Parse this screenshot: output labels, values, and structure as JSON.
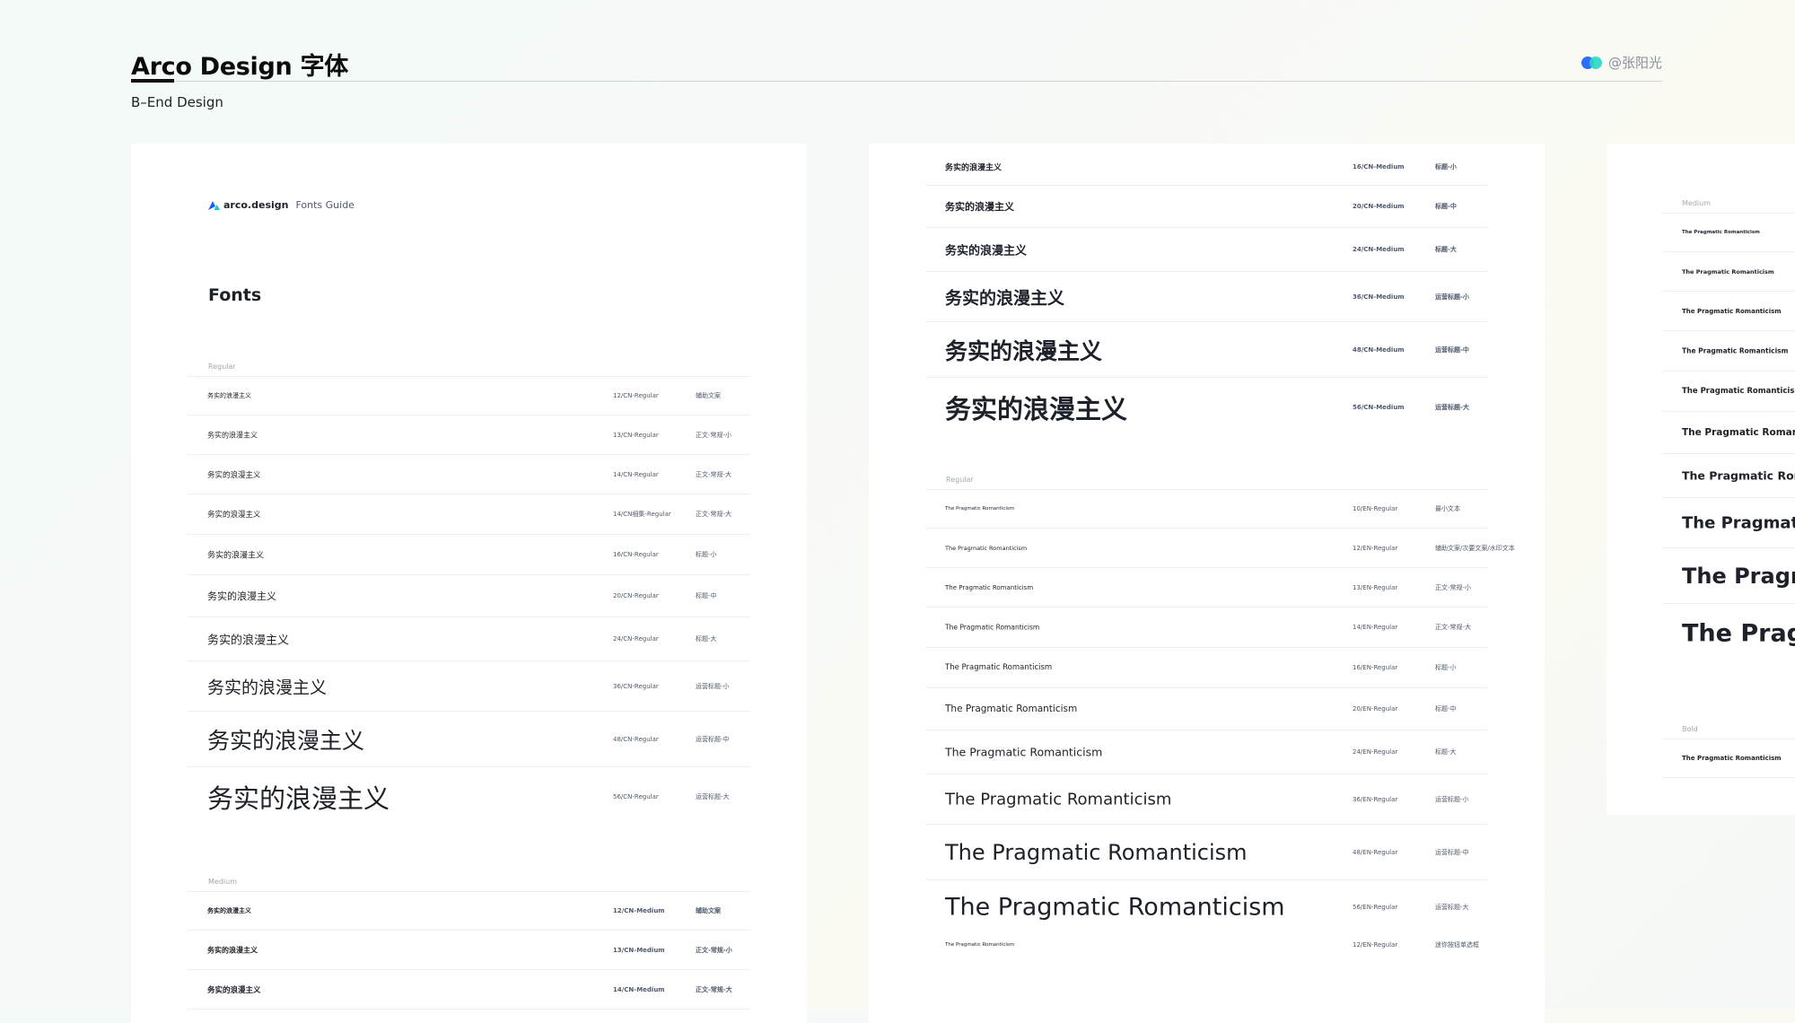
{
  "header": {
    "title": "Arco Design 字体",
    "subtitle": "B–End Design",
    "author": "@张阳光"
  },
  "card1": {
    "brand": "arco.design",
    "guide": "Fonts Guide",
    "heading": "Fonts",
    "regular_label": "Regular",
    "medium_label": "Medium",
    "regular_rows": [
      {
        "sample": "务实的浪漫主义",
        "spec": "12/CN-Regular",
        "use": "辅助文案"
      },
      {
        "sample": "务实的浪漫主义",
        "spec": "13/CN-Regular",
        "use": "正文-常规-小"
      },
      {
        "sample": "务实的浪漫主义",
        "spec": "14/CN-Regular",
        "use": "正文-常规-大"
      },
      {
        "sample": "务实的浪漫主义",
        "spec": "14/CN细集-Regular",
        "use": "正文-常规-大"
      },
      {
        "sample": "务实的浪漫主义",
        "spec": "16/CN-Regular",
        "use": "标题-小"
      },
      {
        "sample": "务实的浪漫主义",
        "spec": "20/CN-Regular",
        "use": "标题-中"
      },
      {
        "sample": "务实的浪漫主义",
        "spec": "24/CN-Regular",
        "use": "标题-大"
      },
      {
        "sample": "务实的浪漫主义",
        "spec": "36/CN-Regular",
        "use": "运营标题-小"
      },
      {
        "sample": "务实的浪漫主义",
        "spec": "48/CN-Regular",
        "use": "运营标题-中"
      },
      {
        "sample": "务实的浪漫主义",
        "spec": "56/CN-Regular",
        "use": "运营标题-大"
      }
    ],
    "medium_rows": [
      {
        "sample": "务实的浪漫主义",
        "spec": "12/CN-Medium",
        "use": "辅助文案"
      },
      {
        "sample": "务实的浪漫主义",
        "spec": "13/CN-Medium",
        "use": "正文-常规-小"
      },
      {
        "sample": "务实的浪漫主义",
        "spec": "14/CN-Medium",
        "use": "正文-常规-大"
      }
    ]
  },
  "card2": {
    "regular_label": "Regular",
    "medium_rows": [
      {
        "sample": "务实的浪漫主义",
        "spec": "16/CN-Medium",
        "use": "标题-小"
      },
      {
        "sample": "务实的浪漫主义",
        "spec": "20/CN-Medium",
        "use": "标题-中"
      },
      {
        "sample": "务实的浪漫主义",
        "spec": "24/CN-Medium",
        "use": "标题-大"
      },
      {
        "sample": "务实的浪漫主义",
        "spec": "36/CN-Medium",
        "use": "运营标题-小"
      },
      {
        "sample": "务实的浪漫主义",
        "spec": "48/CN-Medium",
        "use": "运营标题-中"
      },
      {
        "sample": "务实的浪漫主义",
        "spec": "56/CN-Medium",
        "use": "运营标题-大"
      }
    ],
    "en_rows": [
      {
        "sample": "The Pragmatic Romanticism",
        "spec": "10/EN-Regular",
        "use": "最小文本"
      },
      {
        "sample": "The Pragmatic Romanticism",
        "spec": "12/EN-Regular",
        "use": "辅助文案/次要文案/水印文本"
      },
      {
        "sample": "The Pragmatic Romanticism",
        "spec": "13/EN-Regular",
        "use": "正文-常规-小"
      },
      {
        "sample": "The Pragmatic Romanticism",
        "spec": "14/EN-Regular",
        "use": "正文-常规-大"
      },
      {
        "sample": "The Pragmatic Romanticism",
        "spec": "16/EN-Regular",
        "use": "标题-小"
      },
      {
        "sample": "The Pragmatic Romanticism",
        "spec": "20/EN-Regular",
        "use": "标题-中"
      },
      {
        "sample": "The Pragmatic Romanticism",
        "spec": "24/EN-Regular",
        "use": "标题-大"
      },
      {
        "sample": "The Pragmatic Romanticism",
        "spec": "36/EN-Regular",
        "use": "运营标题-小"
      },
      {
        "sample": "The Pragmatic Romanticism",
        "spec": "48/EN-Regular",
        "use": "运营标题-中"
      },
      {
        "sample": "The Pragmatic Romanticism",
        "spec": "56/EN-Regular",
        "use": "运营标题-大"
      },
      {
        "sample": "The Pragmatic Romanticism",
        "spec": "12/EN-Regular",
        "use": "迷你按钮单选框"
      }
    ]
  },
  "card3": {
    "medium_label": "Medium",
    "bold_label": "Bold",
    "rows": [
      {
        "sample": "The Pragmatic Romanticism"
      },
      {
        "sample": "The Pragmatic Romanticism"
      },
      {
        "sample": "The Pragmatic Romanticism"
      },
      {
        "sample": "The Pragmatic Romanticism"
      },
      {
        "sample": "The Pragmatic Romanticism"
      },
      {
        "sample": "The Pragmatic Romanticism"
      },
      {
        "sample": "The Pragmatic Romanticism"
      },
      {
        "sample": "The Pragmatic Romanticism"
      },
      {
        "sample": "The Pragmatic Romanticism"
      },
      {
        "sample": "The Pragmatic Romanticism"
      }
    ],
    "bold_rows": [
      {
        "sample": "The Pragmatic Romanticism"
      }
    ]
  }
}
